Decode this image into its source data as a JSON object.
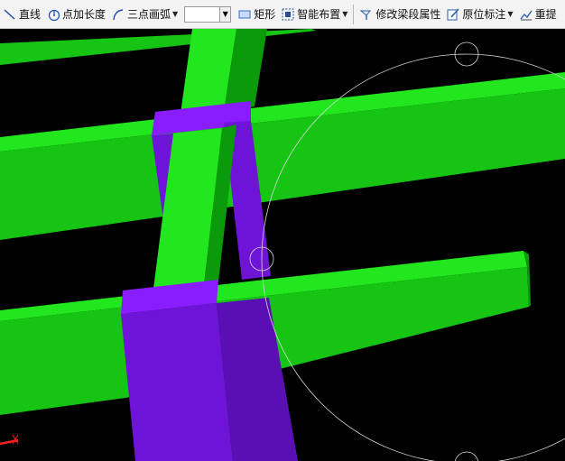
{
  "toolbar": {
    "line_label": "直线",
    "point_length_label": "点加长度",
    "arc_label": "三点画弧",
    "combo_value": "",
    "rect_label": "矩形",
    "smart_layout_label": "智能布置",
    "modify_beam_label": "修改梁段属性",
    "in_situ_label": "原位标注",
    "re_extract_label": "重提"
  },
  "colors": {
    "beam_light": "#22e61e",
    "beam_mid": "#16c414",
    "beam_dark": "#0a9a0a",
    "column_top": "#8a1dff",
    "column_face": "#6d14d6",
    "column_side": "#5a0fb4",
    "background": "#000000"
  },
  "icons": [
    "line-icon",
    "point-length-icon",
    "arc-icon",
    "rect-icon",
    "smart-layout-icon",
    "modify-beam-icon",
    "in-situ-icon",
    "re-extract-icon",
    "axis-origin-icon"
  ]
}
